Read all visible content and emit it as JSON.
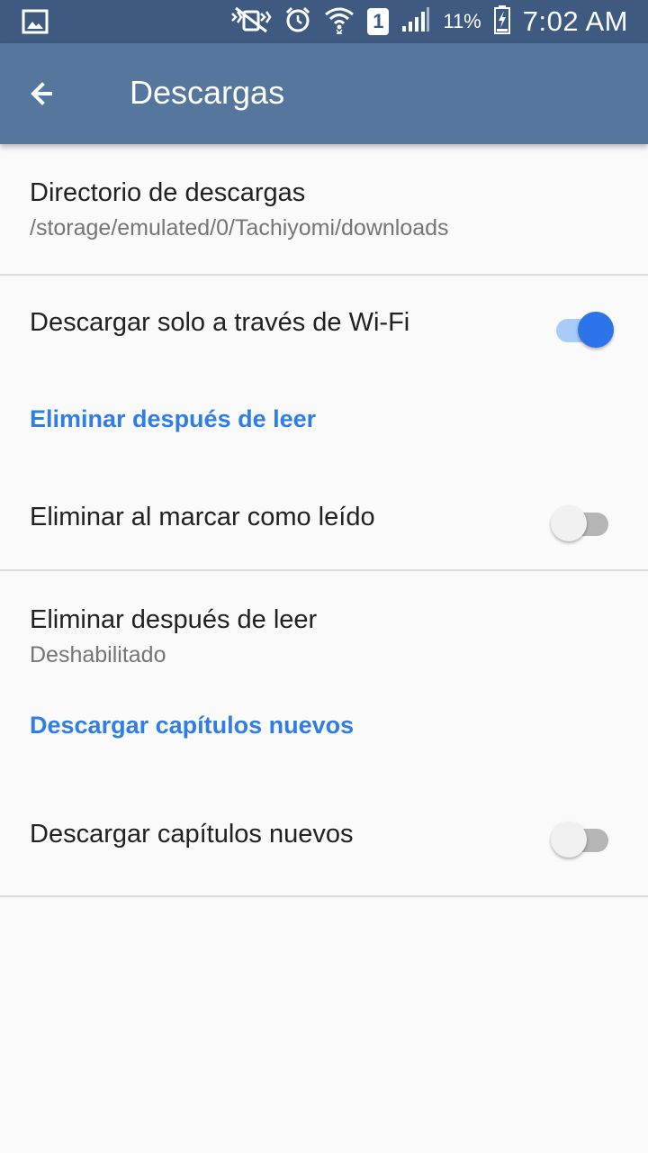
{
  "status_bar": {
    "time": "7:02 AM",
    "battery_percent": "11%",
    "sim_label": "1",
    "icons": [
      "gallery-icon",
      "mute-icon",
      "alarm-icon",
      "wifi-icon",
      "sim-icon",
      "signal-icon",
      "battery-charging-icon"
    ]
  },
  "appbar": {
    "title": "Descargas",
    "back_icon": "arrow-back-icon"
  },
  "preferences": {
    "download_dir": {
      "title": "Directorio de descargas",
      "summary": "/storage/emulated/0/Tachiyomi/downloads"
    },
    "wifi_only": {
      "title": "Descargar solo a través de Wi-Fi",
      "checked": true
    },
    "category_delete": "Eliminar después de leer",
    "remove_on_mark_read": {
      "title": "Eliminar al marcar como leído",
      "checked": false
    },
    "remove_after_read": {
      "title": "Eliminar después de leer",
      "summary": "Deshabilitado"
    },
    "category_new_chapters": "Descargar capítulos nuevos",
    "download_new": {
      "title": "Descargar capítulos nuevos",
      "checked": false
    }
  },
  "colors": {
    "status_bar": "#3e5a80",
    "app_bar": "#55779e",
    "accent": "#2f7ee6",
    "background": "#fafafa"
  }
}
